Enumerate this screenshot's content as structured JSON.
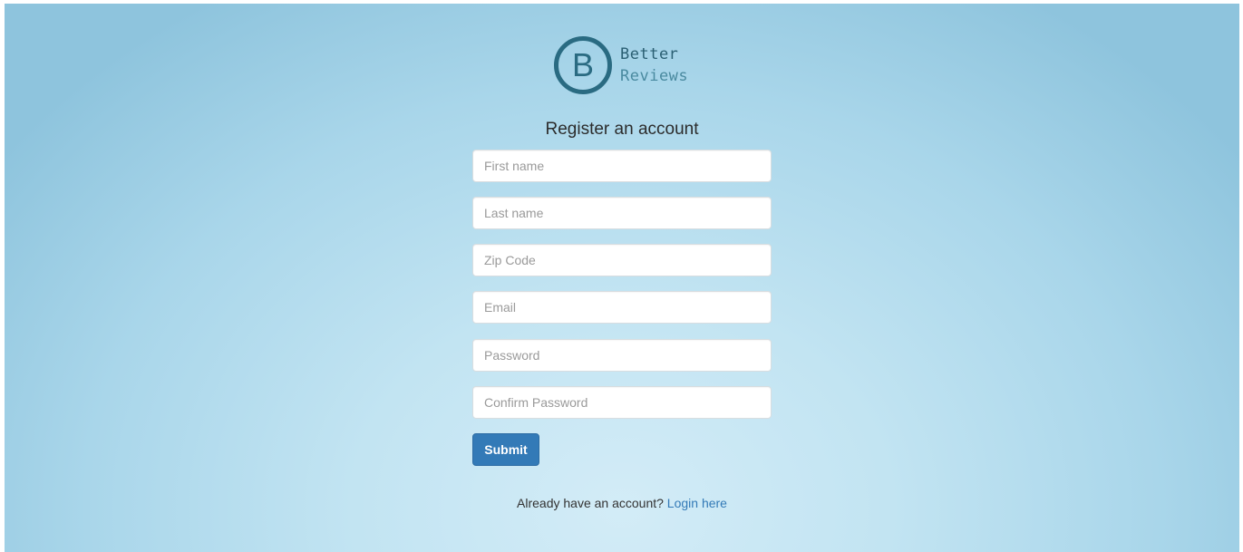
{
  "brand": {
    "logo_letter": "B",
    "name_line1": "Better",
    "name_line2": "Reviews",
    "color_primary": "#2a6b82"
  },
  "form": {
    "title": "Register an account",
    "fields": {
      "first_name": {
        "placeholder": "First name",
        "value": ""
      },
      "last_name": {
        "placeholder": "Last name",
        "value": ""
      },
      "zip_code": {
        "placeholder": "Zip Code",
        "value": ""
      },
      "email": {
        "placeholder": "Email",
        "value": ""
      },
      "password": {
        "placeholder": "Password",
        "value": ""
      },
      "confirm_password": {
        "placeholder": "Confirm Password",
        "value": ""
      }
    },
    "submit_label": "Submit",
    "submit_color": "#337ab7"
  },
  "footer": {
    "prompt": "Already have an account?",
    "login_link": "Login here",
    "link_color": "#337ab7"
  }
}
